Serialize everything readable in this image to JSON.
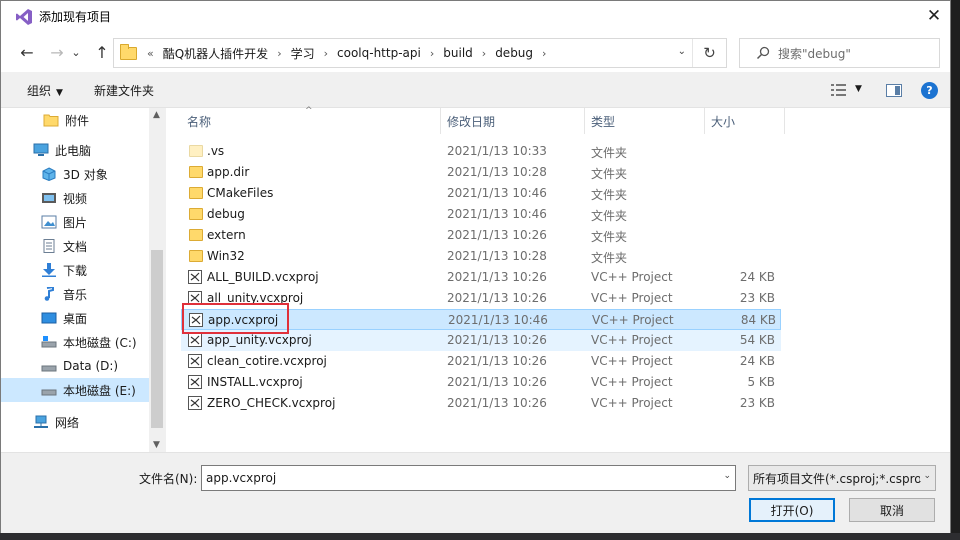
{
  "window": {
    "title": "添加现有项目",
    "close_glyph": "✕"
  },
  "nav_buttons": {
    "back": "←",
    "forward": "→",
    "recent": "⌄",
    "up": "↑"
  },
  "address": {
    "overflow": "«",
    "crumbs": [
      "酷Q机器人插件开发",
      "学习",
      "coolq-http-api",
      "build",
      "debug"
    ],
    "separator": "›",
    "dropdown": "⌄",
    "refresh": "↻"
  },
  "search": {
    "placeholder": "搜索\"debug\""
  },
  "toolbar": {
    "organize_label": "组织",
    "organize_caret": "▼",
    "new_folder_label": "新建文件夹",
    "view_caret": "▼",
    "help_label": "?"
  },
  "navpane": {
    "items": [
      {
        "label": "附件",
        "icon": "folder-icon"
      },
      {
        "label": "此电脑",
        "icon": "computer-icon"
      },
      {
        "label": "3D 对象",
        "icon": "3d-objects-icon"
      },
      {
        "label": "视频",
        "icon": "video-icon"
      },
      {
        "label": "图片",
        "icon": "pictures-icon"
      },
      {
        "label": "文档",
        "icon": "documents-icon"
      },
      {
        "label": "下载",
        "icon": "download-icon"
      },
      {
        "label": "音乐",
        "icon": "music-icon"
      },
      {
        "label": "桌面",
        "icon": "desktop-icon"
      },
      {
        "label": "本地磁盘 (C:)",
        "icon": "drive-icon"
      },
      {
        "label": "Data (D:)",
        "icon": "drive-icon"
      },
      {
        "label": "本地磁盘 (E:)",
        "icon": "drive-icon"
      },
      {
        "label": "网络",
        "icon": "network-icon"
      }
    ],
    "scroll_up": "▲",
    "scroll_down": "▼"
  },
  "filelist": {
    "columns": {
      "name": "名称",
      "date": "修改日期",
      "type": "类型",
      "size": "大小"
    },
    "sort_indicator": "^",
    "rows": [
      {
        "name": ".vs",
        "date": "2021/1/13 10:33",
        "type": "文件夹",
        "size": "",
        "kind": "folder-faded"
      },
      {
        "name": "app.dir",
        "date": "2021/1/13 10:28",
        "type": "文件夹",
        "size": "",
        "kind": "folder"
      },
      {
        "name": "CMakeFiles",
        "date": "2021/1/13 10:46",
        "type": "文件夹",
        "size": "",
        "kind": "folder"
      },
      {
        "name": "debug",
        "date": "2021/1/13 10:46",
        "type": "文件夹",
        "size": "",
        "kind": "folder"
      },
      {
        "name": "extern",
        "date": "2021/1/13 10:26",
        "type": "文件夹",
        "size": "",
        "kind": "folder"
      },
      {
        "name": "Win32",
        "date": "2021/1/13 10:28",
        "type": "文件夹",
        "size": "",
        "kind": "folder"
      },
      {
        "name": "ALL_BUILD.vcxproj",
        "date": "2021/1/13 10:26",
        "type": "VC++ Project",
        "size": "24 KB",
        "kind": "project"
      },
      {
        "name": "all_unity.vcxproj",
        "date": "2021/1/13 10:26",
        "type": "VC++ Project",
        "size": "23 KB",
        "kind": "project"
      },
      {
        "name": "app.vcxproj",
        "date": "2021/1/13 10:46",
        "type": "VC++ Project",
        "size": "84 KB",
        "kind": "project",
        "selected": "strong"
      },
      {
        "name": "app_unity.vcxproj",
        "date": "2021/1/13 10:26",
        "type": "VC++ Project",
        "size": "54 KB",
        "kind": "project",
        "selected": "light"
      },
      {
        "name": "clean_cotire.vcxproj",
        "date": "2021/1/13 10:26",
        "type": "VC++ Project",
        "size": "24 KB",
        "kind": "project"
      },
      {
        "name": "INSTALL.vcxproj",
        "date": "2021/1/13 10:26",
        "type": "VC++ Project",
        "size": "5 KB",
        "kind": "project"
      },
      {
        "name": "ZERO_CHECK.vcxproj",
        "date": "2021/1/13 10:26",
        "type": "VC++ Project",
        "size": "23 KB",
        "kind": "project"
      }
    ]
  },
  "bottom": {
    "filename_label": "文件名(N):",
    "filename_value": "app.vcxproj",
    "filename_dropdown": "⌄",
    "filter_value": "所有项目文件(*.csproj;*.cspro",
    "filter_dropdown": "⌄",
    "open_label": "打开(O)",
    "cancel_label": "取消"
  },
  "colors": {
    "accent": "#0078d7",
    "selection": "#cce8ff",
    "highlight_box": "#e0303a",
    "folder": "#ffd96b"
  }
}
